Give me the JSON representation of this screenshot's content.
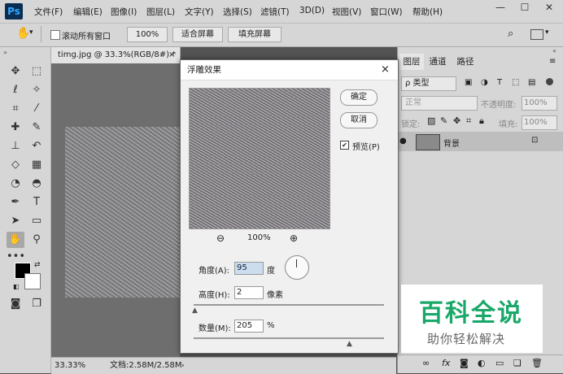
{
  "menubar": {
    "logo": "Ps",
    "items": [
      "文件(F)",
      "编辑(E)",
      "图像(I)",
      "图层(L)",
      "文字(Y)",
      "选择(S)",
      "滤镜(T)",
      "3D(D)",
      "视图(V)",
      "窗口(W)",
      "帮助(H)"
    ],
    "minimize": "—",
    "maximize": "☐",
    "close": "✕"
  },
  "options": {
    "hand_icon": "hand-icon",
    "scroll_all": "滚动所有窗口",
    "zoom_100": "100%",
    "fit_screen": "适合屏幕",
    "fill_screen": "填充屏幕"
  },
  "document": {
    "tab_title": "timg.jpg @ 33.3%(RGB/8#) *",
    "tab_close": "×"
  },
  "status": {
    "zoom": "33.33%",
    "doc_info": "文档:2.58M/2.58M"
  },
  "dialog": {
    "title": "浮雕效果",
    "close": "×",
    "ok": "确定",
    "cancel": "取消",
    "preview_label": "预览(P)",
    "preview_checked": true,
    "zoom_out": "⊖",
    "zoom_level": "100%",
    "zoom_in": "⊕",
    "angle_label": "角度(A):",
    "angle_value": "95",
    "angle_unit": "度",
    "height_label": "高度(H):",
    "height_value": "2",
    "height_unit": "像素",
    "amount_label": "数量(M):",
    "amount_value": "205",
    "amount_unit": "%"
  },
  "layers_panel": {
    "tabs": [
      "图层",
      "通道",
      "路径"
    ],
    "kind_filter": "ρ 类型",
    "blend_mode": "正常",
    "opacity_label": "不透明度:",
    "opacity_value": "100%",
    "lock_label": "锁定:",
    "fill_label": "填充:",
    "fill_value": "100%",
    "layer_name": "背景"
  },
  "watermark": {
    "title": "百科全说",
    "subtitle": "助你轻松解决"
  },
  "colors": {
    "chrome": "#d6d6d6",
    "workspace": "#535353",
    "watermark_green": "#1aa86a"
  }
}
